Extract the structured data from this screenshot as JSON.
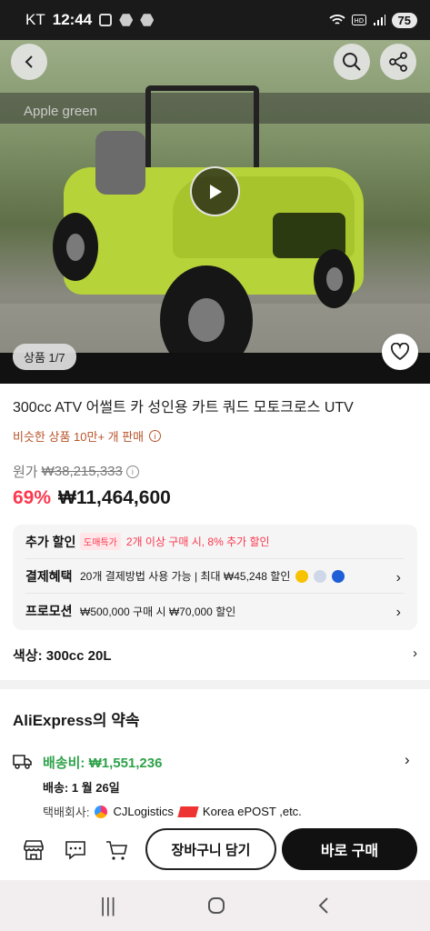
{
  "status_bar": {
    "carrier": "KT",
    "time": "12:44",
    "battery": "75"
  },
  "hero": {
    "image_overlay_text": "Apple green",
    "counter": "상품 1/7"
  },
  "product": {
    "title": "300cc ATV 어썰트 카 성인용 카트 쿼드 모토크로스 UTV",
    "sold_text": "비슷한 상품 10만+ 개 판매",
    "original_label": "원가",
    "original_price": "₩38,215,333",
    "discount": "69%",
    "price": "₩11,464,600"
  },
  "benefits": {
    "extra_discount": {
      "label": "추가 할인",
      "chip": "도매특가",
      "text": "2개 이상 구매 시, 8% 추가 할인"
    },
    "payment": {
      "label": "결제혜택",
      "text": "20개 결제방법 사용 가능 | 최대 ₩45,248 할인"
    },
    "promotion": {
      "label": "프로모션",
      "text": "₩500,000 구매 시 ₩70,000 할인"
    }
  },
  "option": {
    "color_label": "색상: 300cc 20L"
  },
  "promise": {
    "heading": "AliExpress의 약속",
    "shipping_fee": "배송비: ₩1,551,236",
    "delivery_date": "배송: 1 월 26일",
    "courier_label": "택배회사:",
    "courier_1": "CJLogistics",
    "courier_2": "Korea ePOST ,etc."
  },
  "actions": {
    "add_to_cart": "장바구니 담기",
    "buy_now": "바로 구매"
  },
  "colors": {
    "accent_red": "#fd384f",
    "shipping_green": "#2ea24a",
    "sold_orange": "#b8542a"
  }
}
